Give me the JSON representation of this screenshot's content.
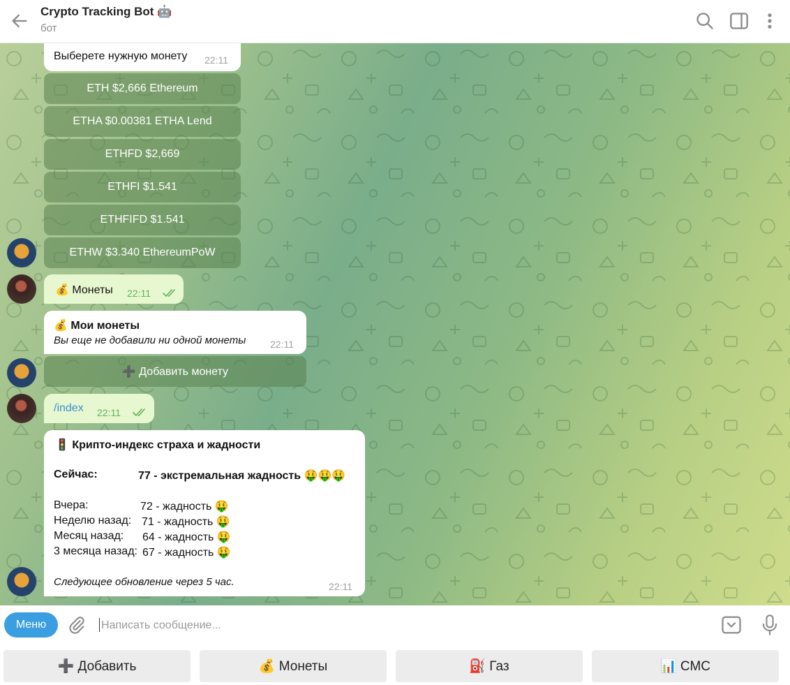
{
  "header": {
    "title": "Crypto Tracking Bot 🤖",
    "subtitle": "бот"
  },
  "messages": {
    "prompt": {
      "text": "Выберете нужную монету",
      "time": "22:11"
    },
    "coin_buttons": [
      "ETH $2,666 Ethereum",
      "ETHA $0.00381 ETHA Lend",
      "ETHFD $2,669",
      "ETHFI $1.541",
      "ETHFIFD $1.541",
      "ETHW $3.340 EthereumPoW"
    ],
    "user_coins": {
      "text": "💰 Монеты",
      "time": "22:11"
    },
    "my_coins": {
      "title": "💰 Мои монеты",
      "body": "Вы еще не добавили ни одной монеты",
      "time": "22:11",
      "add_button": "➕ Добавить монету"
    },
    "user_index": {
      "text": "/index",
      "time": "22:11"
    },
    "fear_index": {
      "title": "🚦 Крипто-индекс страха и жадности",
      "now_label": "Сейчас:",
      "now_value": "77 - экстремальная жадность 🤑🤑🤑",
      "rows": [
        {
          "label": "Вчера:",
          "value": "72 - жадность 🤑"
        },
        {
          "label": "Неделю назад:",
          "value": "71 - жадность 🤑"
        },
        {
          "label": "Месяц назад:",
          "value": "64 - жадность 🤑"
        },
        {
          "label": "3 месяца назад:",
          "value": "67 - жадность 🤑"
        }
      ],
      "footer": "Следующее обновление через 5 час.",
      "time": "22:11"
    }
  },
  "composer": {
    "menu_label": "Меню",
    "placeholder": "Написать сообщение..."
  },
  "reply_keyboard": [
    "➕ Добавить",
    "💰 Монеты",
    "⛽ Газ",
    "📊 СМС"
  ],
  "colors": {
    "accent": "#3a9ee0",
    "outgoing_bubble": "#e7f8d0",
    "check_marks": "#5db15a"
  },
  "icons": [
    "back-arrow-icon",
    "search-icon",
    "sidebar-toggle-icon",
    "more-vert-icon",
    "attach-icon",
    "bot-keyboard-icon",
    "microphone-icon",
    "double-check-icon"
  ]
}
